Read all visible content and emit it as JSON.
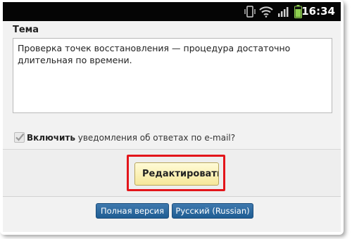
{
  "status_bar": {
    "time": "16:34",
    "icons": [
      "vibrate-icon",
      "wifi-icon",
      "signal-icon",
      "battery-icon"
    ]
  },
  "form": {
    "topic_label": "Тема",
    "topic_text": "Проверка точек восстановления — процедура достаточно длительная по времени.",
    "notify_bold": "Включить",
    "notify_text": " уведомления об ответах по e-mail?",
    "notify_checked": true
  },
  "edit_button_label": "Редактировать",
  "footer": {
    "full_version_label": "Полная версия",
    "language_label": "Русский (Russian)"
  },
  "colors": {
    "highlight": "#e3151a",
    "footer_button": "#2a669e",
    "edit_button": "#f6e79a"
  }
}
